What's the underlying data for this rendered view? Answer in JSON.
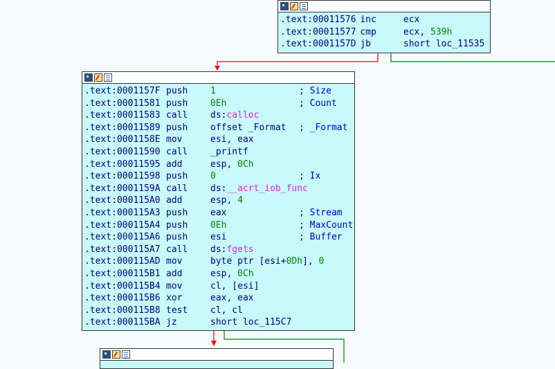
{
  "colors": {
    "node_bg": "#c8fafa",
    "edge_true": "#ff0000",
    "edge_false": "#008000",
    "edge_flow": "#000080"
  },
  "top_node": {
    "lines": [
      {
        "addr": ".text:00011576",
        "mn": "inc",
        "op": "ecx",
        "comment": ""
      },
      {
        "addr": ".text:00011577",
        "mn": "cmp",
        "op": "ecx, 539h",
        "comment": ""
      },
      {
        "addr": ".text:0001157D",
        "mn": "jb",
        "op": "short loc_11535",
        "comment": ""
      }
    ]
  },
  "main_node": {
    "lines": [
      {
        "addr": ".text:0001157F",
        "mn": "push",
        "op": "1",
        "comment": "; Size"
      },
      {
        "addr": ".text:00011581",
        "mn": "push",
        "op": "0Eh",
        "comment": "; Count"
      },
      {
        "addr": ".text:00011583",
        "mn": "call",
        "op": "ds:calloc",
        "comment": ""
      },
      {
        "addr": ".text:00011589",
        "mn": "push",
        "op": "offset _Format",
        "comment": "; _Format"
      },
      {
        "addr": ".text:0001158E",
        "mn": "mov",
        "op": "esi, eax",
        "comment": ""
      },
      {
        "addr": ".text:00011590",
        "mn": "call",
        "op": "_printf",
        "comment": ""
      },
      {
        "addr": ".text:00011595",
        "mn": "add",
        "op": "esp, 0Ch",
        "comment": ""
      },
      {
        "addr": ".text:00011598",
        "mn": "push",
        "op": "0",
        "comment": "; Ix"
      },
      {
        "addr": ".text:0001159A",
        "mn": "call",
        "op": "ds:__acrt_iob_func",
        "comment": ""
      },
      {
        "addr": ".text:000115A0",
        "mn": "add",
        "op": "esp, 4",
        "comment": ""
      },
      {
        "addr": ".text:000115A3",
        "mn": "push",
        "op": "eax",
        "comment": "; Stream"
      },
      {
        "addr": ".text:000115A4",
        "mn": "push",
        "op": "0Eh",
        "comment": "; MaxCount"
      },
      {
        "addr": ".text:000115A6",
        "mn": "push",
        "op": "esi",
        "comment": "; Buffer"
      },
      {
        "addr": ".text:000115A7",
        "mn": "call",
        "op": "ds:fgets",
        "comment": ""
      },
      {
        "addr": ".text:000115AD",
        "mn": "mov",
        "op": "byte ptr [esi+0Dh], 0",
        "comment": ""
      },
      {
        "addr": ".text:000115B1",
        "mn": "add",
        "op": "esp, 0Ch",
        "comment": ""
      },
      {
        "addr": ".text:000115B4",
        "mn": "mov",
        "op": "cl, [esi]",
        "comment": ""
      },
      {
        "addr": ".text:000115B6",
        "mn": "xor",
        "op": "eax, eax",
        "comment": ""
      },
      {
        "addr": ".text:000115B8",
        "mn": "test",
        "op": "cl, cl",
        "comment": ""
      },
      {
        "addr": ".text:000115BA",
        "mn": "jz",
        "op": "short loc_115C7",
        "comment": ""
      }
    ]
  },
  "icons": [
    "graph-icon",
    "edit-icon",
    "list-icon"
  ]
}
